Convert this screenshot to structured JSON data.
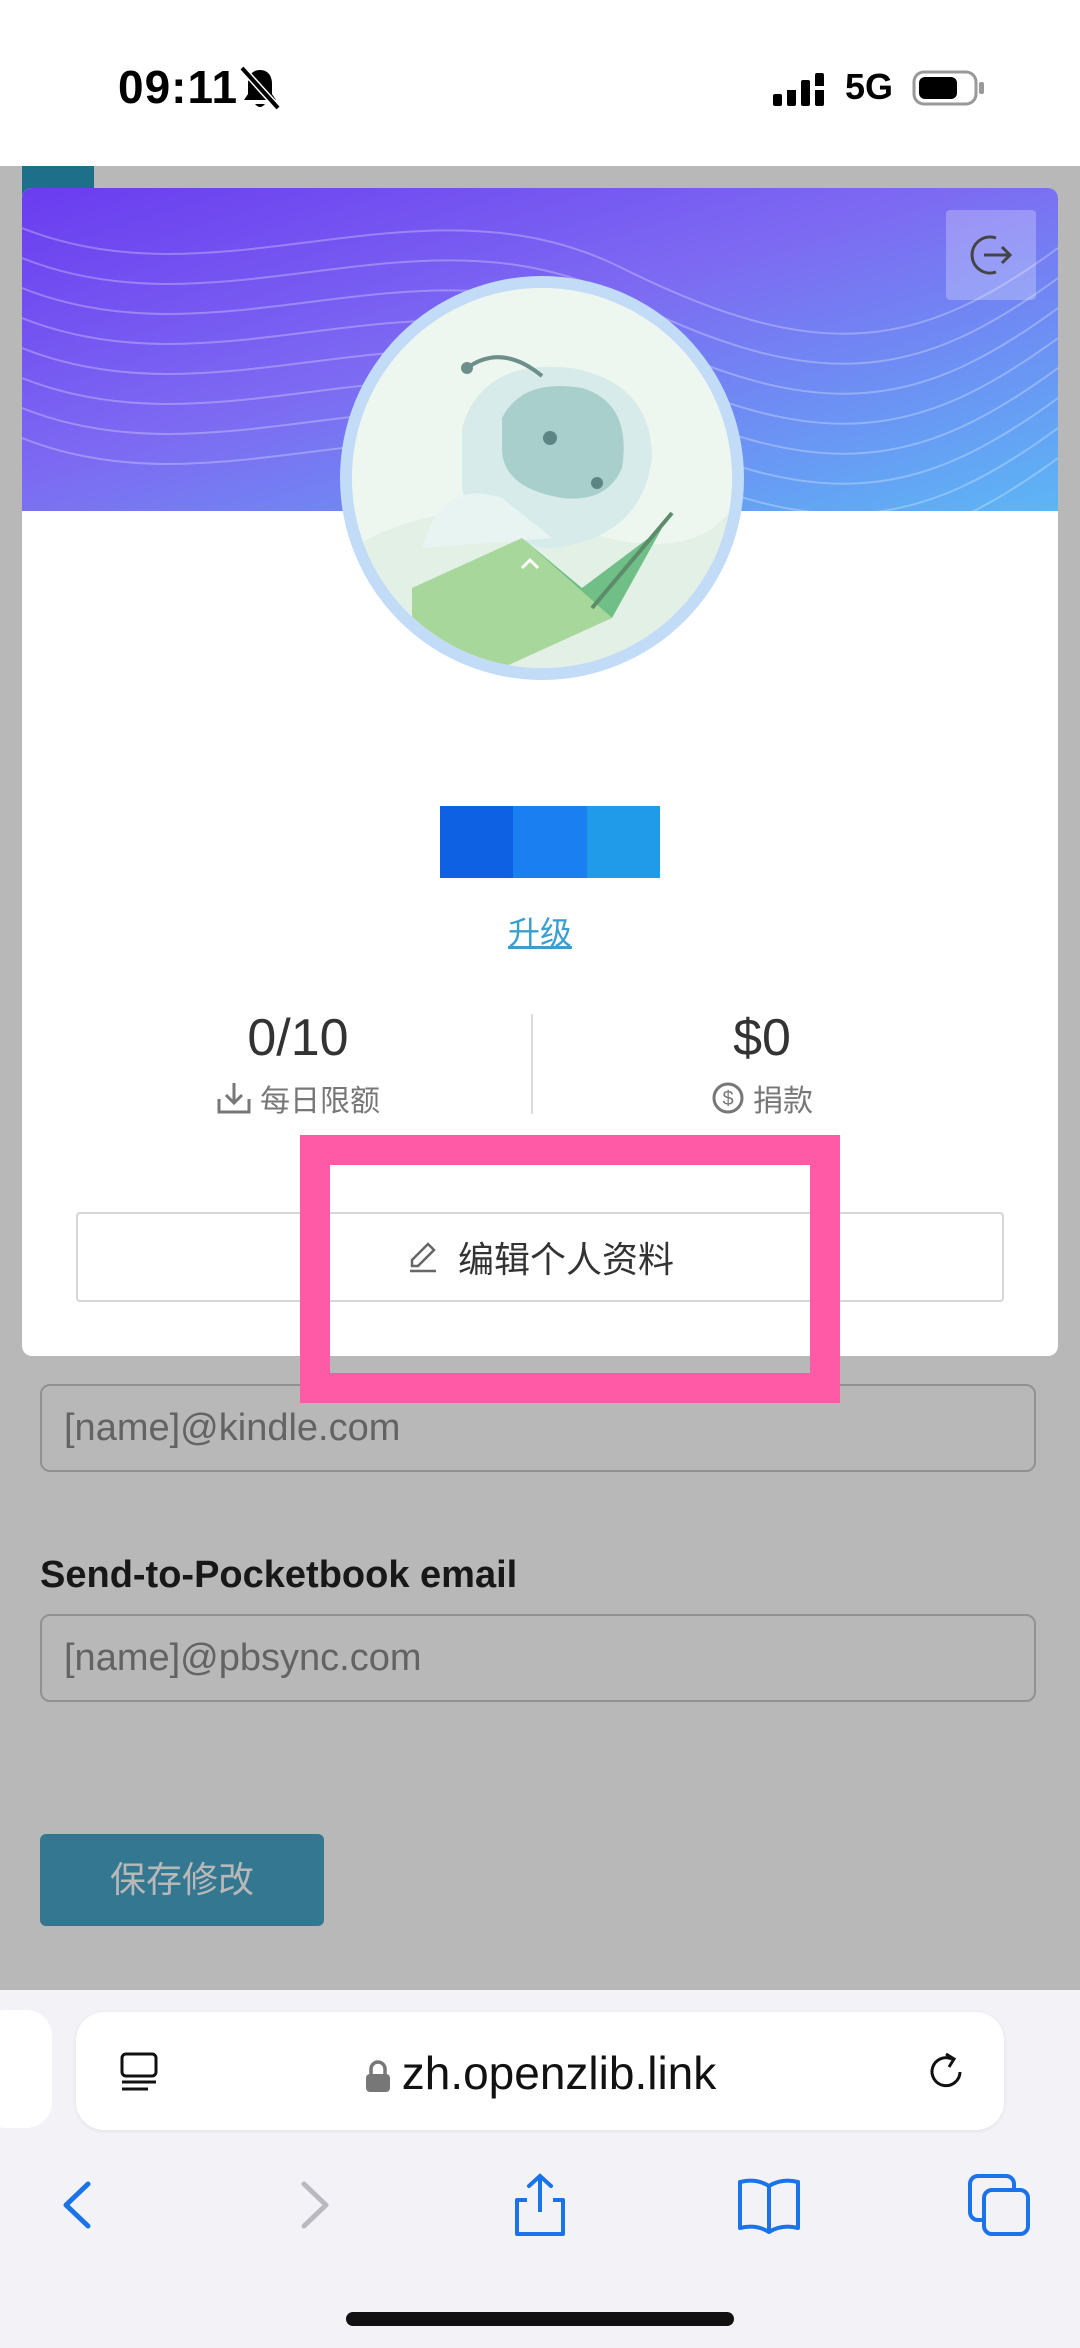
{
  "status_bar": {
    "time": "09:11",
    "network": "5G"
  },
  "background_form": {
    "kindle_placeholder": "[name]@kindle.com",
    "pocketbook_label": "Send-to-Pocketbook email",
    "pocketbook_placeholder": "[name]@pbsync.com",
    "save_label": "保存修改"
  },
  "profile_modal": {
    "upgrade_label": "升级",
    "daily_limit": {
      "value": "0/10",
      "label": "每日限额"
    },
    "donations": {
      "value": "$0",
      "label": "捐款"
    },
    "edit_profile_label": "编辑个人资料"
  },
  "browser": {
    "url": "zh.openzlib.link"
  },
  "colors": {
    "highlight": "#ff5aa5",
    "accent": "#3b9fce",
    "name_bar": [
      "#0f61e4",
      "#1a7ff0",
      "#1f9be9"
    ]
  }
}
